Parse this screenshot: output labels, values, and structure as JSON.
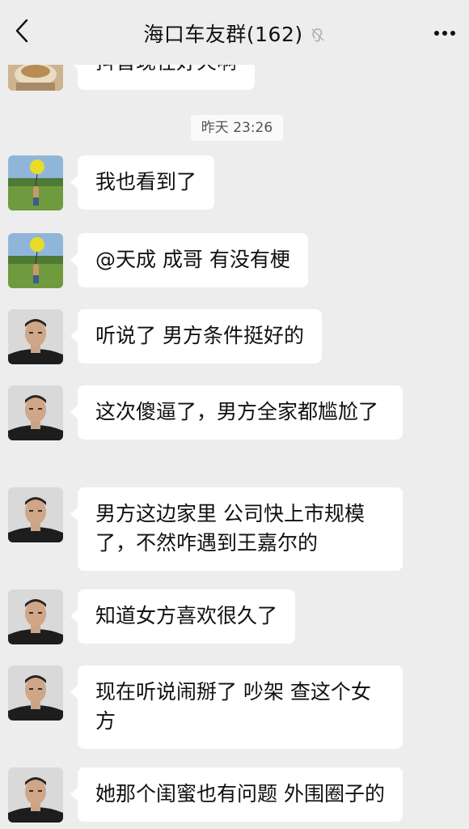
{
  "header": {
    "title": "海口车友群(162)",
    "back_icon": "chevron-left-icon",
    "mute_icon": "ear-mute-icon",
    "more_icon": "more-dots-icon"
  },
  "chat": {
    "timestamp": "昨天 23:26",
    "messages": [
      {
        "sender": "avatar-food",
        "text": "抖音现在好火啊"
      },
      {
        "sender": "avatar-balloon",
        "text": "我也看到了"
      },
      {
        "sender": "avatar-balloon",
        "text": "@天成 成哥 有没有梗"
      },
      {
        "sender": "avatar-man",
        "text": "听说了 男方条件挺好的"
      },
      {
        "sender": "avatar-man",
        "text": "这次傻逼了，男方全家都尴尬了"
      },
      {
        "sender": "avatar-man",
        "text": "男方这边家里 公司快上市规模了，不然咋遇到王嘉尔的"
      },
      {
        "sender": "avatar-man",
        "text": "知道女方喜欢很久了"
      },
      {
        "sender": "avatar-man",
        "text": "现在听说闹掰了 吵架 查这个女方"
      },
      {
        "sender": "avatar-man",
        "text": "她那个闺蜜也有问题 外围圈子的"
      }
    ]
  },
  "colors": {
    "background": "#ededed",
    "bubble": "#ffffff",
    "timestamp_bg": "#fafafa"
  }
}
